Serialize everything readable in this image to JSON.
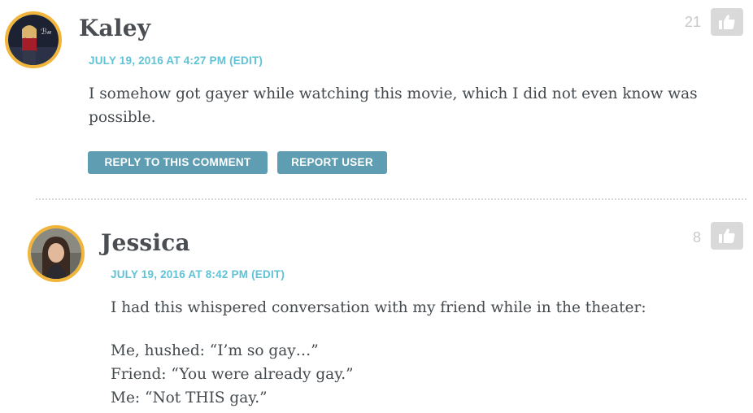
{
  "comments": [
    {
      "author": "Kaley",
      "date": "JULY 19, 2016 AT 4:27 PM",
      "edit_label": "(EDIT)",
      "paragraphs": [
        "I somehow got gayer while watching this movie, which I did not even know was possible."
      ],
      "votes": "21",
      "like_icon": "thumbs-up-icon",
      "buttons": {
        "reply": "REPLY TO THIS COMMENT",
        "report": "REPORT USER"
      }
    },
    {
      "author": "Jessica",
      "date": "JULY 19, 2016 AT 8:42 PM",
      "edit_label": "(EDIT)",
      "paragraphs": [
        "I had this whispered conversation with my friend while in the theater:",
        "Me, hushed: “I’m so gay…”",
        "Friend: “You were already gay.”",
        "Me: “Not THIS gay.”"
      ],
      "votes": "8",
      "like_icon": "thumbs-up-icon"
    }
  ],
  "colors": {
    "accent_date": "#5fc2d6",
    "button_bg": "#5f9db2",
    "avatar_ring": "#f0b53a",
    "like_button_bg": "#d9d9d9"
  }
}
